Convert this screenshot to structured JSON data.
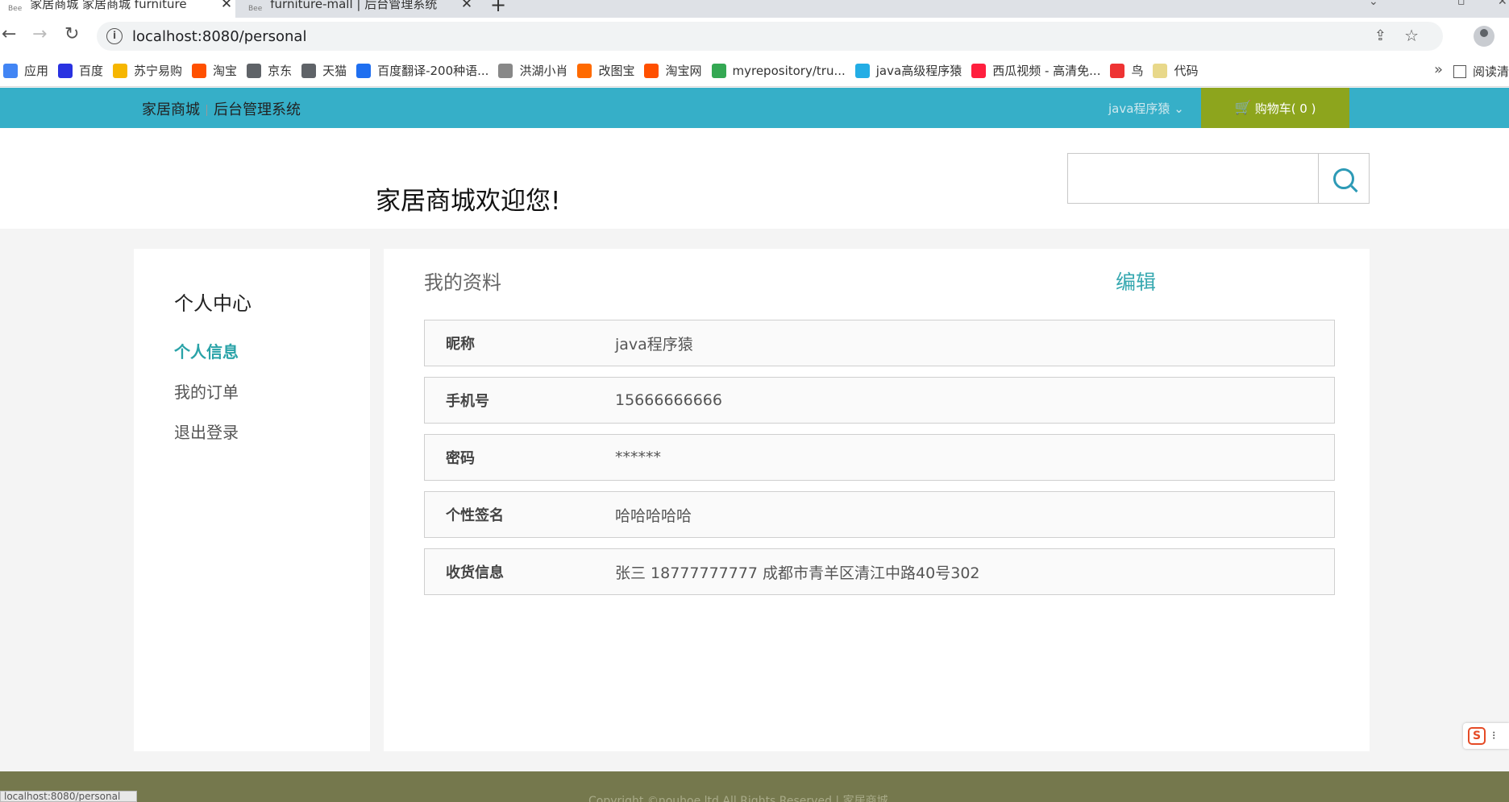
{
  "browser": {
    "tabs": [
      {
        "title": "家居商城 家居商城 furniture",
        "active": true
      },
      {
        "title": "furniture-mall | 后台管理系统",
        "active": false
      }
    ],
    "url": "localhost:8080/personal",
    "bookmarks": [
      {
        "label": "应用",
        "color": "#4285f4"
      },
      {
        "label": "百度",
        "color": "#2932e1"
      },
      {
        "label": "苏宁易购",
        "color": "#f6b600"
      },
      {
        "label": "淘宝",
        "color": "#ff5000"
      },
      {
        "label": "京东",
        "color": "#5f6368"
      },
      {
        "label": "天猫",
        "color": "#5f6368"
      },
      {
        "label": "百度翻译-200种语...",
        "color": "#1f6ff0"
      },
      {
        "label": "洪湖小肖",
        "color": "#888888"
      },
      {
        "label": "改图宝",
        "color": "#ff6a00"
      },
      {
        "label": "淘宝网",
        "color": "#ff5000"
      },
      {
        "label": "myrepository/tru...",
        "color": "#34a853"
      },
      {
        "label": "java高级程序猿",
        "color": "#23ade5"
      },
      {
        "label": "西瓜视频 - 高清免...",
        "color": "#ff1f3e"
      },
      {
        "label": "鸟",
        "color": "#e33"
      },
      {
        "label": "代码",
        "color": "#e8d88a"
      }
    ],
    "more": "»",
    "reading_list": "阅读清",
    "status_url": "localhost:8080/personal"
  },
  "site": {
    "brand": "家居商城",
    "admin_link": "后台管理系统",
    "user_name": "java程序猿",
    "cart_label": "购物车( 0 )",
    "welcome": "家居商城欢迎您!",
    "search_placeholder": ""
  },
  "sidebar": {
    "title": "个人中心",
    "items": [
      {
        "label": "个人信息",
        "active": true
      },
      {
        "label": "我的订单",
        "active": false
      },
      {
        "label": "退出登录",
        "active": false
      }
    ]
  },
  "profile": {
    "title": "我的资料",
    "edit_label": "编辑",
    "fields": [
      {
        "label": "昵称",
        "value": "java程序猿"
      },
      {
        "label": "手机号",
        "value": "15666666666"
      },
      {
        "label": "密码",
        "value": "******"
      },
      {
        "label": "个性签名",
        "value": "哈哈哈哈哈"
      },
      {
        "label": "收货信息",
        "value": "张三 18777777777 成都市青羊区清江中路40号302"
      }
    ]
  },
  "footer": {
    "copyright": "Copyright ©nouhoe ltd All Rights Reserved  |  家居商城"
  },
  "colors": {
    "header_bg": "#36afc8",
    "cart_bg": "#8da51d",
    "accent": "#2aa3a8",
    "footer_bg": "#75784d"
  }
}
